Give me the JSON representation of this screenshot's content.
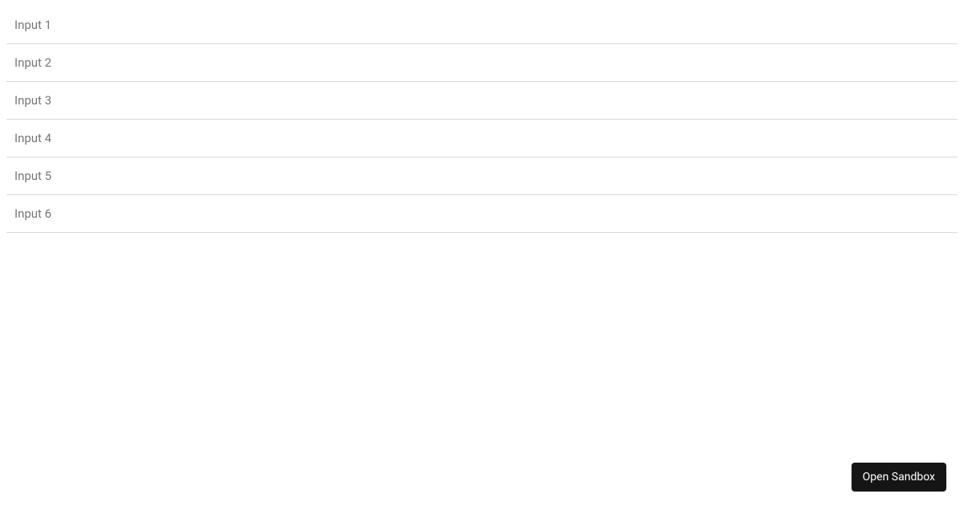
{
  "inputs": [
    {
      "placeholder": "Input 1",
      "value": ""
    },
    {
      "placeholder": "Input 2",
      "value": ""
    },
    {
      "placeholder": "Input 3",
      "value": ""
    },
    {
      "placeholder": "Input 4",
      "value": ""
    },
    {
      "placeholder": "Input 5",
      "value": ""
    },
    {
      "placeholder": "Input 6",
      "value": ""
    }
  ],
  "sandbox_button": {
    "label": "Open Sandbox"
  }
}
